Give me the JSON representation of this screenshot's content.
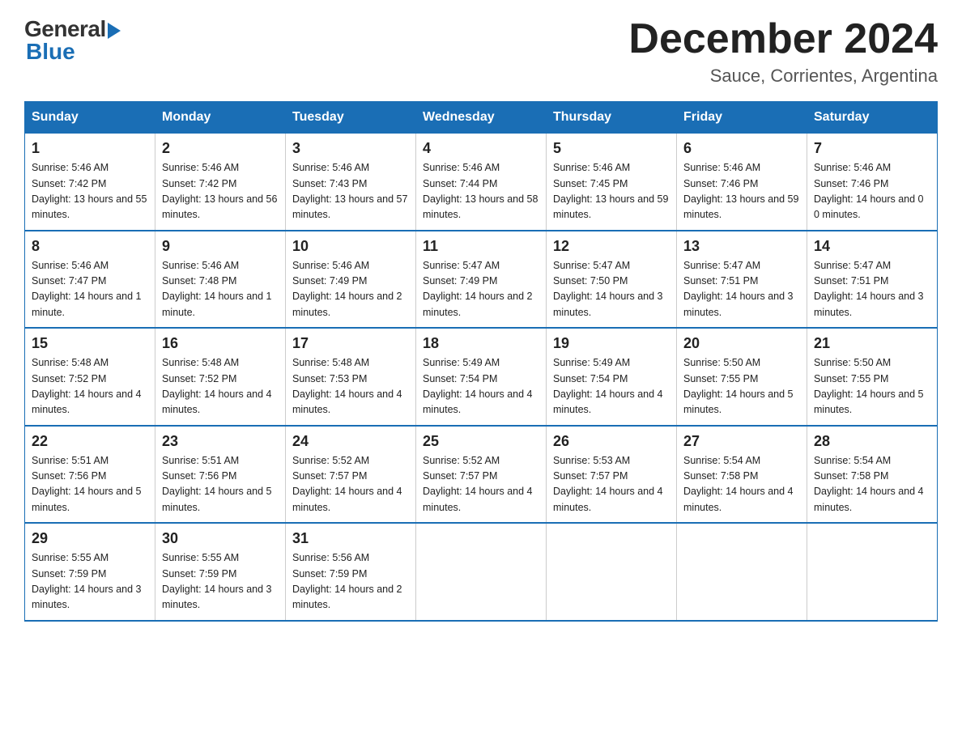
{
  "logo": {
    "general": "General",
    "blue": "Blue"
  },
  "title": "December 2024",
  "subtitle": "Sauce, Corrientes, Argentina",
  "headers": [
    "Sunday",
    "Monday",
    "Tuesday",
    "Wednesday",
    "Thursday",
    "Friday",
    "Saturday"
  ],
  "weeks": [
    [
      {
        "day": "1",
        "sunrise": "5:46 AM",
        "sunset": "7:42 PM",
        "daylight": "13 hours and 55 minutes."
      },
      {
        "day": "2",
        "sunrise": "5:46 AM",
        "sunset": "7:42 PM",
        "daylight": "13 hours and 56 minutes."
      },
      {
        "day": "3",
        "sunrise": "5:46 AM",
        "sunset": "7:43 PM",
        "daylight": "13 hours and 57 minutes."
      },
      {
        "day": "4",
        "sunrise": "5:46 AM",
        "sunset": "7:44 PM",
        "daylight": "13 hours and 58 minutes."
      },
      {
        "day": "5",
        "sunrise": "5:46 AM",
        "sunset": "7:45 PM",
        "daylight": "13 hours and 59 minutes."
      },
      {
        "day": "6",
        "sunrise": "5:46 AM",
        "sunset": "7:46 PM",
        "daylight": "13 hours and 59 minutes."
      },
      {
        "day": "7",
        "sunrise": "5:46 AM",
        "sunset": "7:46 PM",
        "daylight": "14 hours and 0 minutes."
      }
    ],
    [
      {
        "day": "8",
        "sunrise": "5:46 AM",
        "sunset": "7:47 PM",
        "daylight": "14 hours and 1 minute."
      },
      {
        "day": "9",
        "sunrise": "5:46 AM",
        "sunset": "7:48 PM",
        "daylight": "14 hours and 1 minute."
      },
      {
        "day": "10",
        "sunrise": "5:46 AM",
        "sunset": "7:49 PM",
        "daylight": "14 hours and 2 minutes."
      },
      {
        "day": "11",
        "sunrise": "5:47 AM",
        "sunset": "7:49 PM",
        "daylight": "14 hours and 2 minutes."
      },
      {
        "day": "12",
        "sunrise": "5:47 AM",
        "sunset": "7:50 PM",
        "daylight": "14 hours and 3 minutes."
      },
      {
        "day": "13",
        "sunrise": "5:47 AM",
        "sunset": "7:51 PM",
        "daylight": "14 hours and 3 minutes."
      },
      {
        "day": "14",
        "sunrise": "5:47 AM",
        "sunset": "7:51 PM",
        "daylight": "14 hours and 3 minutes."
      }
    ],
    [
      {
        "day": "15",
        "sunrise": "5:48 AM",
        "sunset": "7:52 PM",
        "daylight": "14 hours and 4 minutes."
      },
      {
        "day": "16",
        "sunrise": "5:48 AM",
        "sunset": "7:52 PM",
        "daylight": "14 hours and 4 minutes."
      },
      {
        "day": "17",
        "sunrise": "5:48 AM",
        "sunset": "7:53 PM",
        "daylight": "14 hours and 4 minutes."
      },
      {
        "day": "18",
        "sunrise": "5:49 AM",
        "sunset": "7:54 PM",
        "daylight": "14 hours and 4 minutes."
      },
      {
        "day": "19",
        "sunrise": "5:49 AM",
        "sunset": "7:54 PM",
        "daylight": "14 hours and 4 minutes."
      },
      {
        "day": "20",
        "sunrise": "5:50 AM",
        "sunset": "7:55 PM",
        "daylight": "14 hours and 5 minutes."
      },
      {
        "day": "21",
        "sunrise": "5:50 AM",
        "sunset": "7:55 PM",
        "daylight": "14 hours and 5 minutes."
      }
    ],
    [
      {
        "day": "22",
        "sunrise": "5:51 AM",
        "sunset": "7:56 PM",
        "daylight": "14 hours and 5 minutes."
      },
      {
        "day": "23",
        "sunrise": "5:51 AM",
        "sunset": "7:56 PM",
        "daylight": "14 hours and 5 minutes."
      },
      {
        "day": "24",
        "sunrise": "5:52 AM",
        "sunset": "7:57 PM",
        "daylight": "14 hours and 4 minutes."
      },
      {
        "day": "25",
        "sunrise": "5:52 AM",
        "sunset": "7:57 PM",
        "daylight": "14 hours and 4 minutes."
      },
      {
        "day": "26",
        "sunrise": "5:53 AM",
        "sunset": "7:57 PM",
        "daylight": "14 hours and 4 minutes."
      },
      {
        "day": "27",
        "sunrise": "5:54 AM",
        "sunset": "7:58 PM",
        "daylight": "14 hours and 4 minutes."
      },
      {
        "day": "28",
        "sunrise": "5:54 AM",
        "sunset": "7:58 PM",
        "daylight": "14 hours and 4 minutes."
      }
    ],
    [
      {
        "day": "29",
        "sunrise": "5:55 AM",
        "sunset": "7:59 PM",
        "daylight": "14 hours and 3 minutes."
      },
      {
        "day": "30",
        "sunrise": "5:55 AM",
        "sunset": "7:59 PM",
        "daylight": "14 hours and 3 minutes."
      },
      {
        "day": "31",
        "sunrise": "5:56 AM",
        "sunset": "7:59 PM",
        "daylight": "14 hours and 2 minutes."
      },
      null,
      null,
      null,
      null
    ]
  ],
  "labels": {
    "sunrise": "Sunrise:",
    "sunset": "Sunset:",
    "daylight": "Daylight:"
  }
}
